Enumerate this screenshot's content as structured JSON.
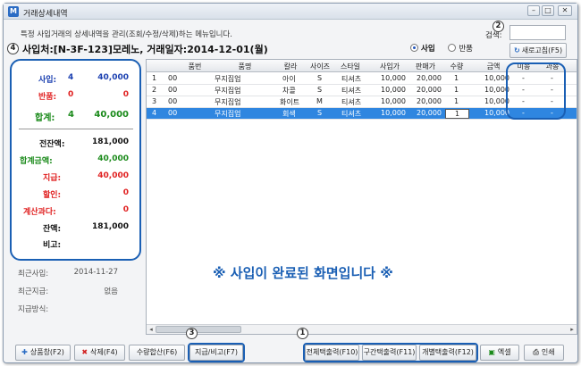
{
  "window": {
    "title": "거래상세내역",
    "app_icon": "M",
    "buttons": [
      "–",
      "□",
      "✕"
    ]
  },
  "description": "특정 사입거래의 상세내역을 관리(조회/수정/삭제)하는 메뉴입니다.",
  "search": {
    "label": "검색:",
    "value": ""
  },
  "refresh_button": "새로고침(F5)",
  "header": "사입처:[N-3F-123]모레노, 거래일자:2014-12-01(월)",
  "radio_options": [
    {
      "label": "사입",
      "selected": true
    },
    {
      "label": "반품",
      "selected": false
    }
  ],
  "callouts": {
    "c1": "1",
    "c2": "2",
    "c3": "3",
    "c4": "4"
  },
  "summary_top": {
    "purchase": {
      "label": "사입:",
      "qty": "4",
      "amount": "40,000"
    },
    "returns": {
      "label": "반품:",
      "qty": "0",
      "amount": "0"
    },
    "total": {
      "label": "합계:",
      "qty": "4",
      "amount": "40,000"
    }
  },
  "summary_bottom": [
    {
      "label": "전잔액:",
      "value": "181,000"
    },
    {
      "label": "합계금액:",
      "value": "40,000"
    },
    {
      "label": "지급:",
      "value": "40,000"
    },
    {
      "label": "할인:",
      "value": "0"
    },
    {
      "label": "계산과다:",
      "value": "0"
    },
    {
      "label": "잔액:",
      "value": "181,000"
    },
    {
      "label": "비고:",
      "value": ""
    }
  ],
  "info": [
    {
      "label": "최근사입:",
      "value": "2014-11-27"
    },
    {
      "label": "최근지급:",
      "value": "없음"
    },
    {
      "label": "지급방식:",
      "value": ""
    }
  ],
  "grid": {
    "columns": [
      "품번",
      "품명",
      "칼라",
      "사이즈",
      "스타일",
      "사입가",
      "판매가",
      "수량",
      "금액",
      "미송",
      "과송"
    ],
    "rows": [
      [
        "1",
        "00",
        "무지집업",
        "아이",
        "S",
        "티셔츠",
        "10,000",
        "20,000",
        "1",
        "10,000",
        "-",
        "-"
      ],
      [
        "2",
        "00",
        "무지집업",
        "차콜",
        "S",
        "티셔츠",
        "10,000",
        "20,000",
        "1",
        "10,000",
        "-",
        "-"
      ],
      [
        "3",
        "00",
        "무지집업",
        "화이트",
        "M",
        "티셔츠",
        "10,000",
        "20,000",
        "1",
        "10,000",
        "-",
        "-"
      ],
      [
        "4",
        "00",
        "무지집업",
        "회색",
        "S",
        "티셔츠",
        "10,000",
        "20,000",
        "1",
        "10,000",
        "-",
        "-"
      ]
    ],
    "selected_row": 3
  },
  "done_message": "※ 사입이 완료된 화면입니다 ※",
  "buttons": {
    "add_product": "상품창(F2)",
    "delete": "삭제(F4)",
    "qty_sum": "수량합산(F6)",
    "pay_note": "지급/비고(F7)",
    "print_all": "전체택출력(F10)",
    "print_range": "구간택출력(F11)",
    "print_each": "개별택출력(F12)",
    "excel": "엑셀",
    "print": "인쇄"
  },
  "colors": {
    "accent": "#1a5fb4",
    "selection": "#2f86e0",
    "blue": "#1a3fb0",
    "red": "#e02020",
    "green": "#1a8a1a"
  }
}
